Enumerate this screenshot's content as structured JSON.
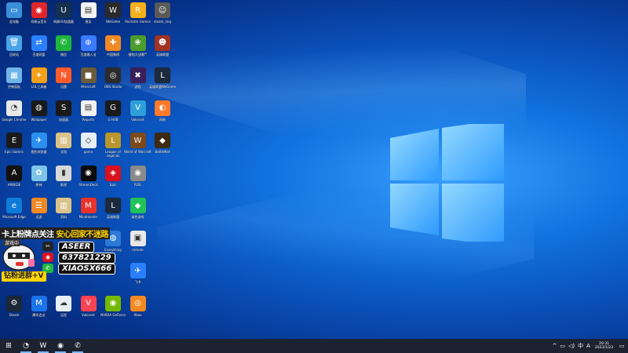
{
  "desktop": {
    "icons": [
      {
        "label": "此电脑",
        "glyph": "▭",
        "color": "#3b8ed9",
        "col": 0,
        "row": 0
      },
      {
        "label": "网易云音乐",
        "glyph": "◉",
        "color": "#e0262b",
        "col": 1,
        "row": 0
      },
      {
        "label": "网易UU加速器",
        "glyph": "U",
        "color": "#14314f",
        "col": 2,
        "row": 0
      },
      {
        "label": "报告",
        "glyph": "▤",
        "color": "#f2f2f2",
        "col": 3,
        "row": 0
      },
      {
        "label": "WeGame",
        "glyph": "W",
        "color": "#2a2a2a",
        "col": 4,
        "row": 0
      },
      {
        "label": "Rockstar Games",
        "glyph": "R",
        "color": "#f7b01d",
        "col": 5,
        "row": 0
      },
      {
        "label": "steam_img",
        "glyph": "☺",
        "color": "#5a5a5a",
        "col": 6,
        "row": 0
      },
      {
        "label": "回收站",
        "glyph": "🗑",
        "color": "#4aa3e8",
        "col": 0,
        "row": 1
      },
      {
        "label": "百度网盘",
        "glyph": "⇄",
        "color": "#2a7fff",
        "col": 1,
        "row": 1
      },
      {
        "label": "微信",
        "glyph": "✆",
        "color": "#1fb63e",
        "col": 2,
        "row": 1
      },
      {
        "label": "百度输入法",
        "glyph": "⊕",
        "color": "#3a7bff",
        "col": 3,
        "row": 1
      },
      {
        "label": "中国象棋",
        "glyph": "✚",
        "color": "#f08a24",
        "col": 4,
        "row": 1
      },
      {
        "label": "植物大战僵尸",
        "glyph": "❀",
        "color": "#4c9c2e",
        "col": 5,
        "row": 1
      },
      {
        "label": "英雄联盟",
        "glyph": "☻",
        "color": "#a13322",
        "col": 6,
        "row": 1
      },
      {
        "label": "控制面板",
        "glyph": "▦",
        "color": "#6fb4e8",
        "col": 0,
        "row": 2
      },
      {
        "label": "LOL工具箱",
        "glyph": "✦",
        "color": "#f3a11b",
        "col": 1,
        "row": 2
      },
      {
        "label": "迅雷",
        "glyph": "N",
        "color": "#ff5a2a",
        "col": 2,
        "row": 2
      },
      {
        "label": "Minecraft",
        "glyph": "■",
        "color": "#6b5b3a",
        "col": 3,
        "row": 2
      },
      {
        "label": "OBS Studio",
        "glyph": "◎",
        "color": "#2b2b2b",
        "col": 4,
        "row": 2
      },
      {
        "label": "游戏",
        "glyph": "✖",
        "color": "#3b1f5c",
        "col": 5,
        "row": 2
      },
      {
        "label": "英雄联盟WeGame",
        "glyph": "L",
        "color": "#1b2a3c",
        "col": 6,
        "row": 2
      },
      {
        "label": "Google Chrome",
        "glyph": "◔",
        "color": "#e8e8e8",
        "col": 0,
        "row": 3
      },
      {
        "label": "Wallpaper",
        "glyph": "◍",
        "color": "#1a1a1a",
        "col": 1,
        "row": 3
      },
      {
        "label": "加速器",
        "glyph": "S",
        "color": "#1a1a1a",
        "col": 2,
        "row": 3
      },
      {
        "label": "Reports",
        "glyph": "▤",
        "color": "#f2f2f2",
        "col": 3,
        "row": 3
      },
      {
        "label": "G HUB",
        "glyph": "G",
        "color": "#1a1a1a",
        "col": 4,
        "row": 3
      },
      {
        "label": "Valorant",
        "glyph": "V",
        "color": "#2ea0d9",
        "col": 5,
        "row": 3
      },
      {
        "label": "网易",
        "glyph": "◐",
        "color": "#ff7a2a",
        "col": 6,
        "row": 3
      },
      {
        "label": "Epic Games",
        "glyph": "E",
        "color": "#1b1b1b",
        "col": 0,
        "row": 4
      },
      {
        "label": "猎豹浏览器",
        "glyph": "✈",
        "color": "#2b8ff0",
        "col": 1,
        "row": 4
      },
      {
        "label": "文档",
        "glyph": "▥",
        "color": "#d9c38a",
        "col": 2,
        "row": 4
      },
      {
        "label": "game",
        "glyph": "◇",
        "color": "#e6eef6",
        "col": 3,
        "row": 4
      },
      {
        "label": "League of Legends",
        "glyph": "L",
        "color": "#b8962e",
        "col": 4,
        "row": 4
      },
      {
        "label": "World of Warcraft",
        "glyph": "W",
        "color": "#7a4a1a",
        "col": 5,
        "row": 4
      },
      {
        "label": "BattleNet",
        "glyph": "◆",
        "color": "#3d2a10",
        "col": 6,
        "row": 4
      },
      {
        "label": "ARKKDE",
        "glyph": "A",
        "color": "#111111",
        "col": 0,
        "row": 5
      },
      {
        "label": "原神",
        "glyph": "✿",
        "color": "#7fc4e8",
        "col": 1,
        "row": 5
      },
      {
        "label": "影视",
        "glyph": "▮",
        "color": "#d8d8d8",
        "col": 2,
        "row": 5
      },
      {
        "label": "StreamDeck",
        "glyph": "◉",
        "color": "#0b0b0b",
        "col": 3,
        "row": 5
      },
      {
        "label": "Epic",
        "glyph": "◈",
        "color": "#d8121f",
        "col": 4,
        "row": 5
      },
      {
        "label": "ROG",
        "glyph": "◉",
        "color": "#8a8a8a",
        "col": 5,
        "row": 5
      },
      {
        "label": "Microsoft Edge",
        "glyph": "e",
        "color": "#0f7bd8",
        "col": 0,
        "row": 6
      },
      {
        "label": "迅游",
        "glyph": "☰",
        "color": "#f08a24",
        "col": 1,
        "row": 6
      },
      {
        "label": "资料",
        "glyph": "▥",
        "color": "#d9c38a",
        "col": 2,
        "row": 6
      },
      {
        "label": "Mindmaster",
        "glyph": "M",
        "color": "#e8332b",
        "col": 3,
        "row": 6
      },
      {
        "label": "英雄联盟",
        "glyph": "L",
        "color": "#1b2a3c",
        "col": 4,
        "row": 6
      },
      {
        "label": "绿色游戏",
        "glyph": "◆",
        "color": "#21c25a",
        "col": 5,
        "row": 6
      },
      {
        "label": "Everything",
        "glyph": "◍",
        "color": "#2c7ad6",
        "col": 4,
        "row": 7
      },
      {
        "label": "remote",
        "glyph": "▣",
        "color": "#e8e8e8",
        "col": 5,
        "row": 7
      },
      {
        "label": "飞书",
        "glyph": "✈",
        "color": "#2a7fff",
        "col": 5,
        "row": 8
      },
      {
        "label": "Steam",
        "glyph": "⚙",
        "color": "#1b2838",
        "col": 0,
        "row": 9
      },
      {
        "label": "腾讯会议",
        "glyph": "M",
        "color": "#1a74e8",
        "col": 1,
        "row": 9
      },
      {
        "label": "远程",
        "glyph": "☁",
        "color": "#e6eef6",
        "col": 2,
        "row": 9
      },
      {
        "label": "Valorant",
        "glyph": "V",
        "color": "#fa4454",
        "col": 3,
        "row": 9
      },
      {
        "label": "NVIDIA GeForce",
        "glyph": "◉",
        "color": "#76b900",
        "col": 4,
        "row": 9
      },
      {
        "label": "Xbox",
        "glyph": "◎",
        "color": "#f08a24",
        "col": 5,
        "row": 9
      }
    ]
  },
  "overlay": {
    "line1_white": "卡上粉牌点关注",
    "line1_yellow": "安心回家不迷路",
    "badge": "游戏中",
    "box1": "ASEER",
    "box2": "637821229",
    "box3": "XIAOSX666",
    "bottom": "钻粉进群+V"
  },
  "taskbar": {
    "apps": [
      {
        "name": "start",
        "glyph": "⊞"
      },
      {
        "name": "chrome",
        "glyph": "◔"
      },
      {
        "name": "wegame",
        "glyph": "W"
      },
      {
        "name": "browser",
        "glyph": "◉"
      },
      {
        "name": "wechat",
        "glyph": "✆"
      }
    ],
    "time": "20:31",
    "date": "2023/1/23",
    "tray": [
      "^",
      "▭",
      "◁)",
      "中",
      "A"
    ]
  },
  "colors": {
    "accent": "#7ab8ff",
    "taskbar": "#1d2230"
  }
}
